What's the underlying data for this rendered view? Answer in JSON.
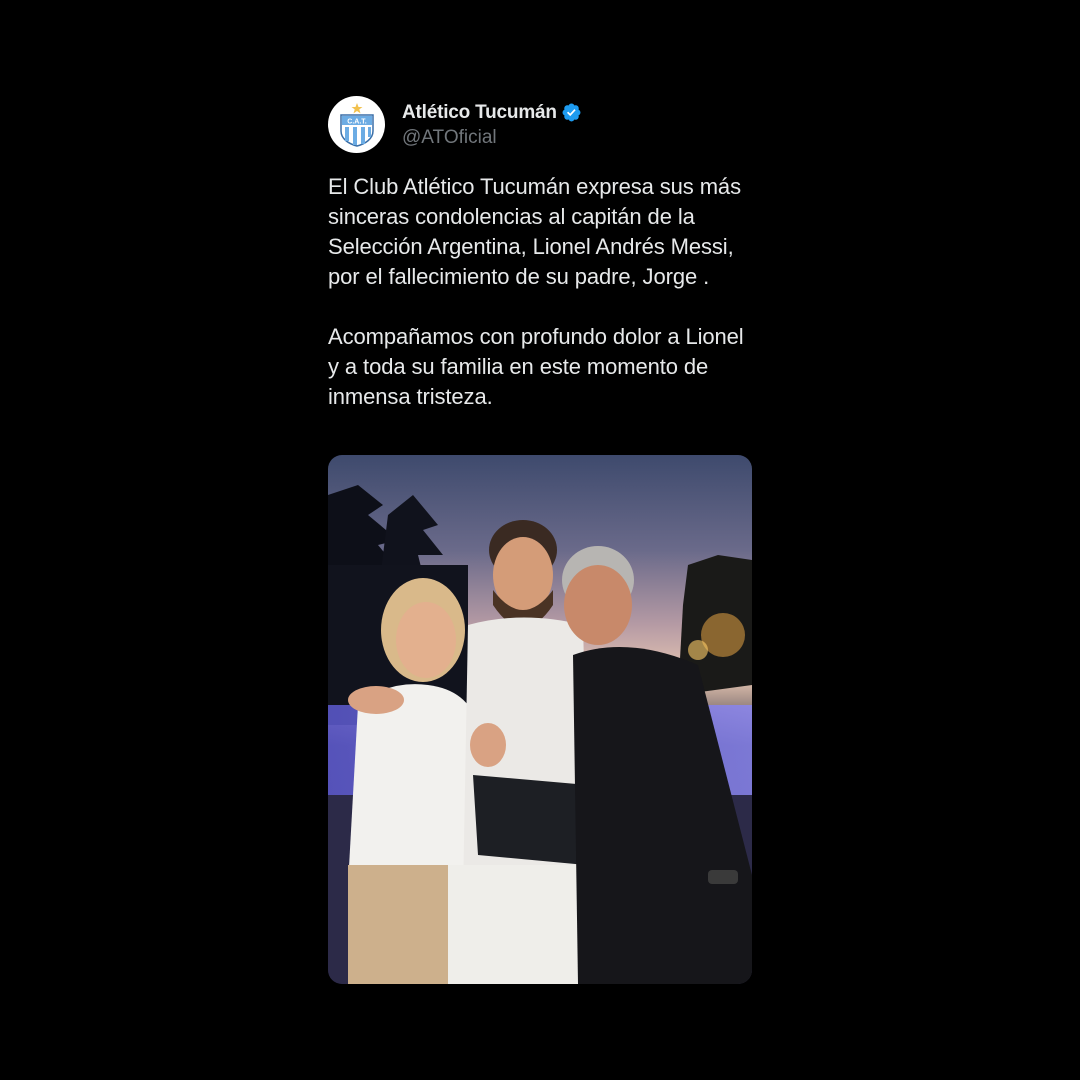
{
  "tweet": {
    "author": {
      "display_name": "Atlético Tucumán",
      "handle": "@ATOficial",
      "verified": true,
      "avatar_crest_text": "C.A.T."
    },
    "text": "El Club Atlético Tucumán expresa sus más sinceras condolencias al capitán de la Selección Argentina, Lionel Andrés Messi, por el fallecimiento de su padre, Jorge .\n\nAcompañamos con profundo dolor a Lionel y a toda  su familia en este momento de inmensa tristeza.",
    "media": {
      "type": "photo",
      "icon": "photo"
    }
  },
  "colors": {
    "background": "#000000",
    "text_primary": "#e7e9ea",
    "text_secondary": "#71767b",
    "verified_badge": "#1d9bf0",
    "crest_blue": "#6cace4"
  }
}
